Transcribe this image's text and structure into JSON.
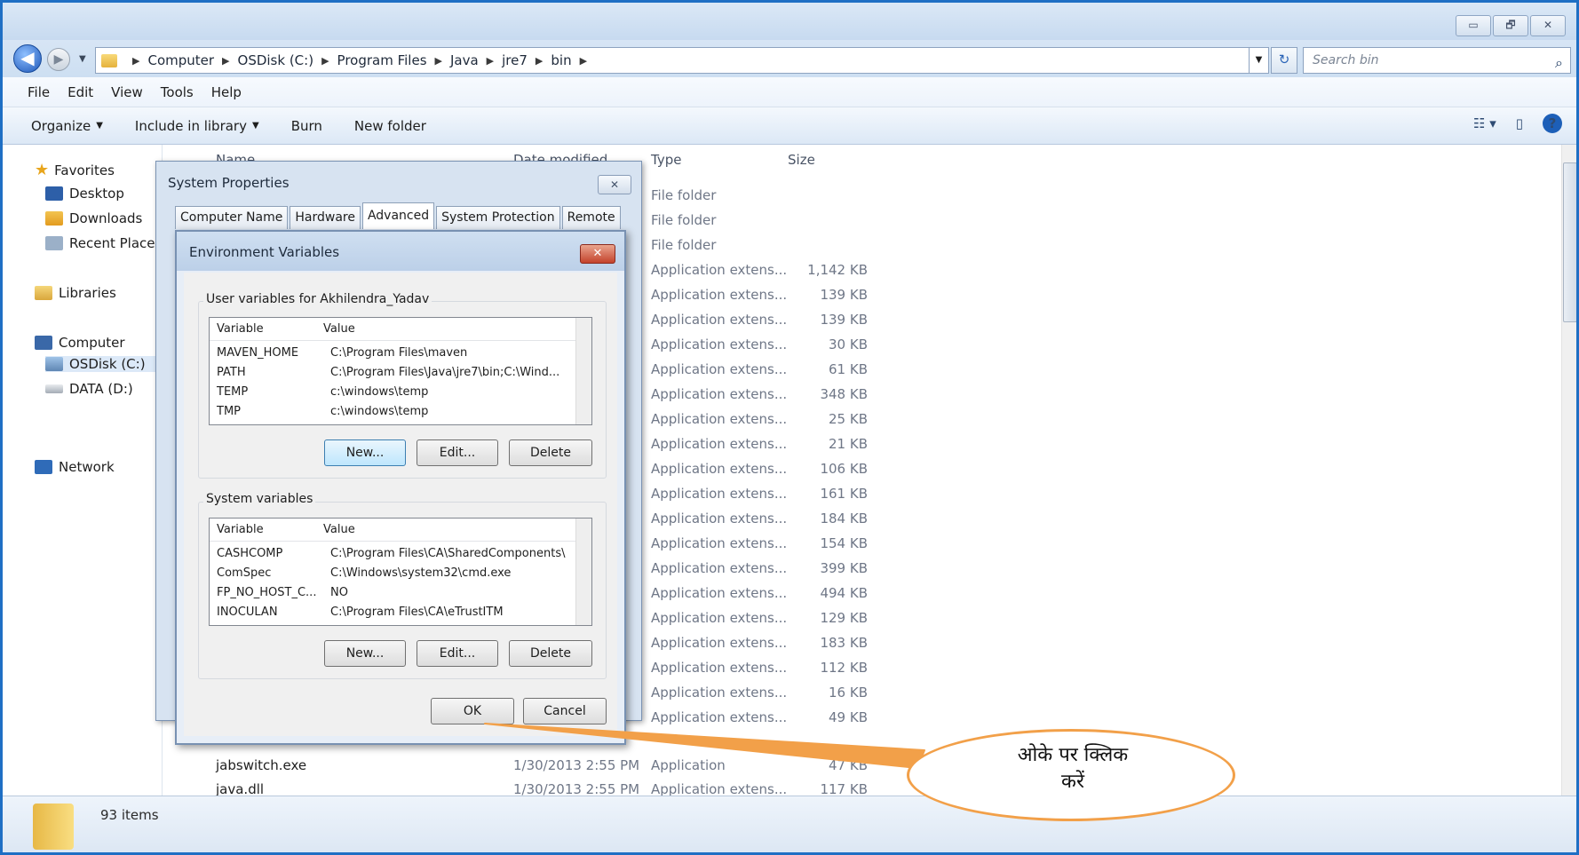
{
  "window": {
    "caption_buttons": [
      "▭",
      "🗗",
      "✕"
    ]
  },
  "address": {
    "crumbs": [
      "Computer",
      "OSDisk (C:)",
      "Program Files",
      "Java",
      "jre7",
      "bin"
    ],
    "search_placeholder": "Search bin"
  },
  "menu": [
    "File",
    "Edit",
    "View",
    "Tools",
    "Help"
  ],
  "toolbar": {
    "organize": "Organize",
    "include": "Include in library",
    "burn": "Burn",
    "new_folder": "New folder"
  },
  "nav": {
    "favorites": "Favorites",
    "desktop": "Desktop",
    "downloads": "Downloads",
    "recent": "Recent Places",
    "libraries": "Libraries",
    "computer": "Computer",
    "osdisk": "OSDisk (C:)",
    "data": "DATA (D:)",
    "network": "Network"
  },
  "columns": {
    "name": "Name",
    "date": "Date modified",
    "type": "Type",
    "size": "Size"
  },
  "files": [
    {
      "type": "File folder",
      "size": ""
    },
    {
      "type": "File folder",
      "size": ""
    },
    {
      "type": "File folder",
      "size": ""
    },
    {
      "type": "Application extens...",
      "size": "1,142 KB"
    },
    {
      "type": "Application extens...",
      "size": "139 KB"
    },
    {
      "type": "Application extens...",
      "size": "139 KB"
    },
    {
      "type": "Application extens...",
      "size": "30 KB"
    },
    {
      "type": "Application extens...",
      "size": "61 KB"
    },
    {
      "type": "Application extens...",
      "size": "348 KB"
    },
    {
      "type": "Application extens...",
      "size": "25 KB"
    },
    {
      "type": "Application extens...",
      "size": "21 KB"
    },
    {
      "type": "Application extens...",
      "size": "106 KB"
    },
    {
      "type": "Application extens...",
      "size": "161 KB"
    },
    {
      "type": "Application extens...",
      "size": "184 KB"
    },
    {
      "type": "Application extens...",
      "size": "154 KB"
    },
    {
      "type": "Application extens...",
      "size": "399 KB"
    },
    {
      "type": "Application extens...",
      "size": "494 KB"
    },
    {
      "type": "Application extens...",
      "size": "129 KB"
    },
    {
      "type": "Application extens...",
      "size": "183 KB"
    },
    {
      "type": "Application extens...",
      "size": "112 KB"
    },
    {
      "type": "Application extens...",
      "size": "16 KB"
    },
    {
      "type": "Application extens...",
      "size": "49 KB"
    }
  ],
  "visible_files": [
    {
      "name": "jabswitch.exe",
      "date": "1/30/2013 2:55 PM",
      "type": "Application",
      "size": "47 KB"
    },
    {
      "name": "java.dll",
      "date": "1/30/2013 2:55 PM",
      "type": "Application extens...",
      "size": "117 KB"
    }
  ],
  "status": {
    "items": "93 items"
  },
  "sysprop": {
    "title": "System Properties",
    "tabs": [
      "Computer Name",
      "Hardware",
      "Advanced",
      "System Protection",
      "Remote"
    ]
  },
  "env": {
    "title": "Environment Variables",
    "user_group": "User variables for Akhilendra_Yadav",
    "system_group": "System variables",
    "col_variable": "Variable",
    "col_value": "Value",
    "user_vars": [
      {
        "name": "MAVEN_HOME",
        "value": "C:\\Program Files\\maven"
      },
      {
        "name": "PATH",
        "value": "C:\\Program Files\\Java\\jre7\\bin;C:\\Wind..."
      },
      {
        "name": "TEMP",
        "value": "c:\\windows\\temp"
      },
      {
        "name": "TMP",
        "value": "c:\\windows\\temp"
      }
    ],
    "system_vars": [
      {
        "name": "CASHCOMP",
        "value": "C:\\Program Files\\CA\\SharedComponents\\"
      },
      {
        "name": "ComSpec",
        "value": "C:\\Windows\\system32\\cmd.exe"
      },
      {
        "name": "FP_NO_HOST_C...",
        "value": "NO"
      },
      {
        "name": "INOCULAN",
        "value": "C:\\Program Files\\CA\\eTrustITM"
      }
    ],
    "btn_new": "New...",
    "btn_edit": "Edit...",
    "btn_delete": "Delete",
    "btn_ok": "OK",
    "btn_cancel": "Cancel"
  },
  "callout": {
    "line1": "ओके पर क्लिक",
    "line2": "करें",
    "color": "#f2a049"
  }
}
